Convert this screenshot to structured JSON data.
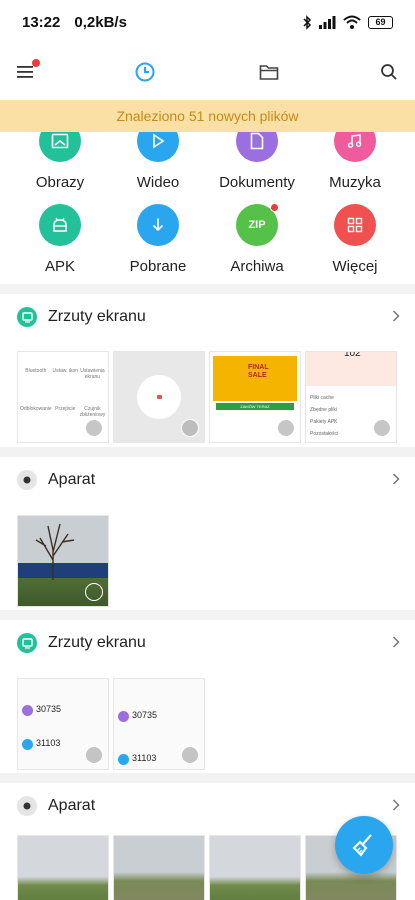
{
  "status_bar": {
    "time": "13:22",
    "speed": "0,2kB/s",
    "battery": "69"
  },
  "toolbar": {
    "menu": "menu-icon",
    "recent": "clock-icon",
    "files": "folder-icon",
    "search": "search-icon"
  },
  "banner": {
    "text": "Znaleziono 51 nowych plików"
  },
  "categories": [
    {
      "label": "Obrazy",
      "color": "#22c19a",
      "icon": "image-icon"
    },
    {
      "label": "Wideo",
      "color": "#2aa6ee",
      "icon": "play-icon"
    },
    {
      "label": "Dokumenty",
      "color": "#9b6fe0",
      "icon": "document-icon"
    },
    {
      "label": "Muzyka",
      "color": "#ef5b9c",
      "icon": "music-icon"
    },
    {
      "label": "APK",
      "color": "#22c19a",
      "icon": "android-icon"
    },
    {
      "label": "Pobrane",
      "color": "#2aa6ee",
      "icon": "download-icon"
    },
    {
      "label": "Archiwa",
      "color": "#56c149",
      "icon": "zip-icon",
      "badge_text": "ZIP"
    },
    {
      "label": "Więcej",
      "color": "#f05050",
      "icon": "grid-icon"
    }
  ],
  "sections": [
    {
      "title": "Zrzuty ekranu",
      "icon": "screenshot-icon",
      "thumbs": [
        {
          "kind": "settings-grid",
          "items": [
            "Bluetooth",
            "Ustaw. ikon",
            "Ustawienia ekranu",
            "Odblokowanie",
            "Przejście",
            "Czujnik zbliżeniowy"
          ]
        },
        {
          "kind": "dial"
        },
        {
          "kind": "sale",
          "lines": [
            "FINAL",
            "SALE",
            "ZAMÓW TERAZ"
          ]
        },
        {
          "kind": "cleaner",
          "top": "102",
          "rows": [
            "Pliki cache",
            "Zbędne pliki",
            "Pakiety APK",
            "Pozostałości"
          ]
        }
      ]
    },
    {
      "title": "Aparat",
      "icon": "camera-icon",
      "thumbs": [
        {
          "kind": "photo-tree"
        }
      ]
    },
    {
      "title": "Zrzuty ekranu",
      "icon": "screenshot-icon",
      "thumbs": [
        {
          "kind": "stats",
          "numbers": [
            "30735",
            "31103"
          ]
        },
        {
          "kind": "stats",
          "numbers": [
            "30735",
            "31103"
          ]
        }
      ]
    },
    {
      "title": "Aparat",
      "icon": "camera-icon",
      "thumbs": [
        {
          "kind": "video"
        },
        {
          "kind": "video"
        },
        {
          "kind": "video"
        },
        {
          "kind": "video"
        }
      ]
    }
  ],
  "fab": {
    "icon": "broom-icon"
  }
}
